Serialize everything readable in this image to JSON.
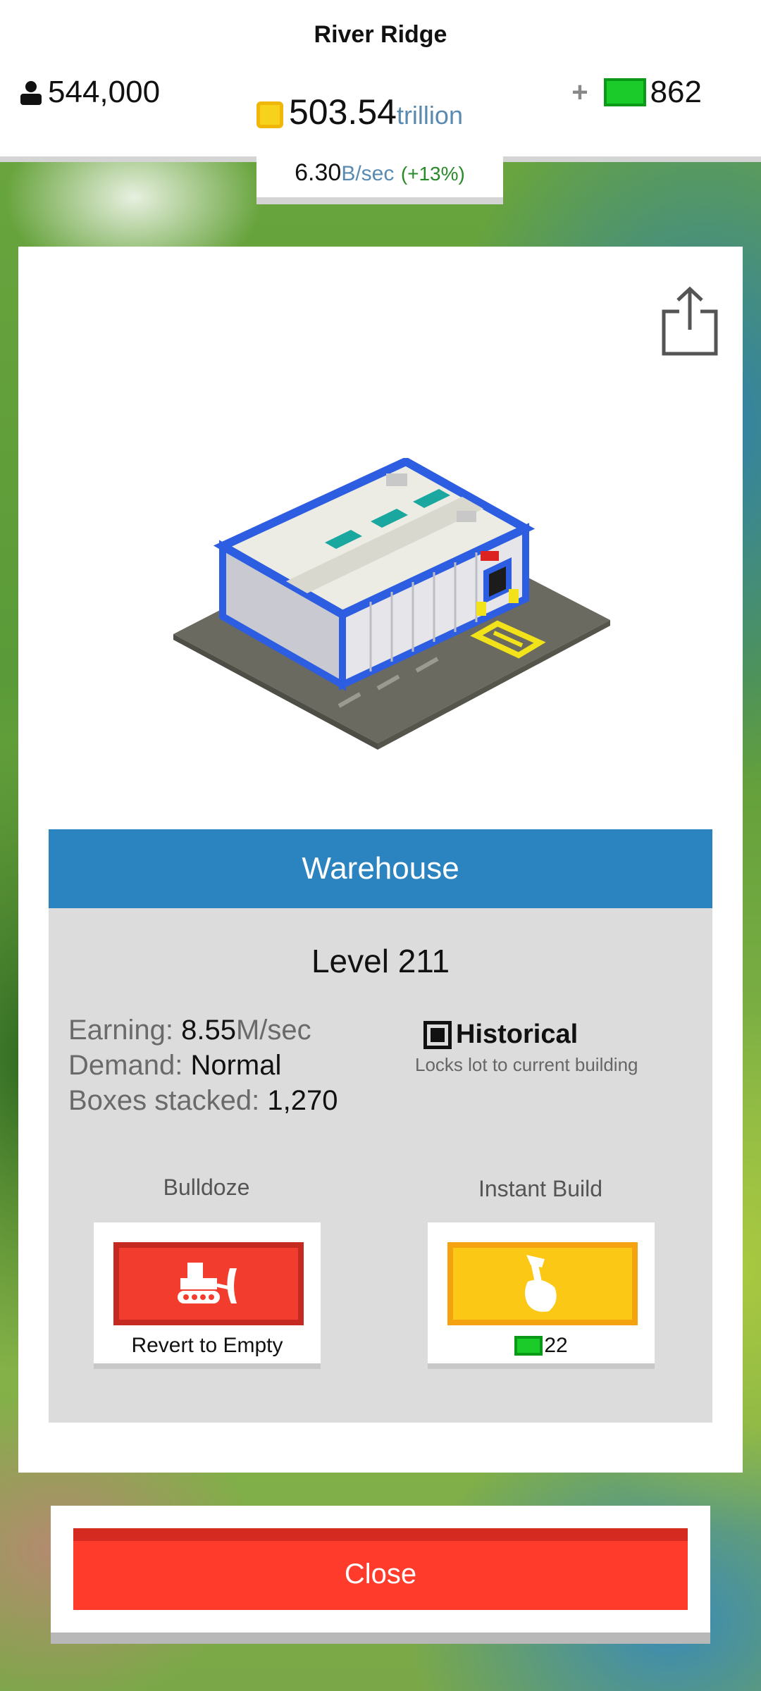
{
  "hud": {
    "city_name": "River Ridge",
    "population": "544,000",
    "coins": "503.54",
    "coins_unit": "trillion",
    "gems_plus": "+",
    "gems": "862",
    "rate_value": "6.30",
    "rate_unit": "B/sec",
    "rate_change": "(+13%)"
  },
  "building": {
    "name": "Warehouse",
    "level": "Level 211",
    "stats": {
      "earning_label": "Earning:",
      "earning_value": "8.55",
      "earning_unit": "M/sec",
      "demand_label": "Demand:",
      "demand_value": "Normal",
      "boxes_label": "Boxes stacked:",
      "boxes_value": "1,270"
    },
    "historical": {
      "label": "Historical",
      "description": "Locks lot to current building"
    }
  },
  "actions": {
    "bulldoze_title": "Bulldoze",
    "bulldoze_label": "Revert to Empty",
    "instant_title": "Instant Build",
    "instant_price": "22"
  },
  "close_label": "Close",
  "icons": {
    "population": "person-icon",
    "coin": "coin-icon",
    "gems": "cash-icon",
    "share": "share-icon",
    "bulldoze": "bulldozer-icon",
    "instant_build": "hammer-icon"
  },
  "colors": {
    "header_blue": "#2b84c0",
    "close_red": "#ff3b2b",
    "bulldoze_red": "#f23d2e",
    "instant_yellow": "#fcc816",
    "cash_green": "#1acb2a"
  }
}
